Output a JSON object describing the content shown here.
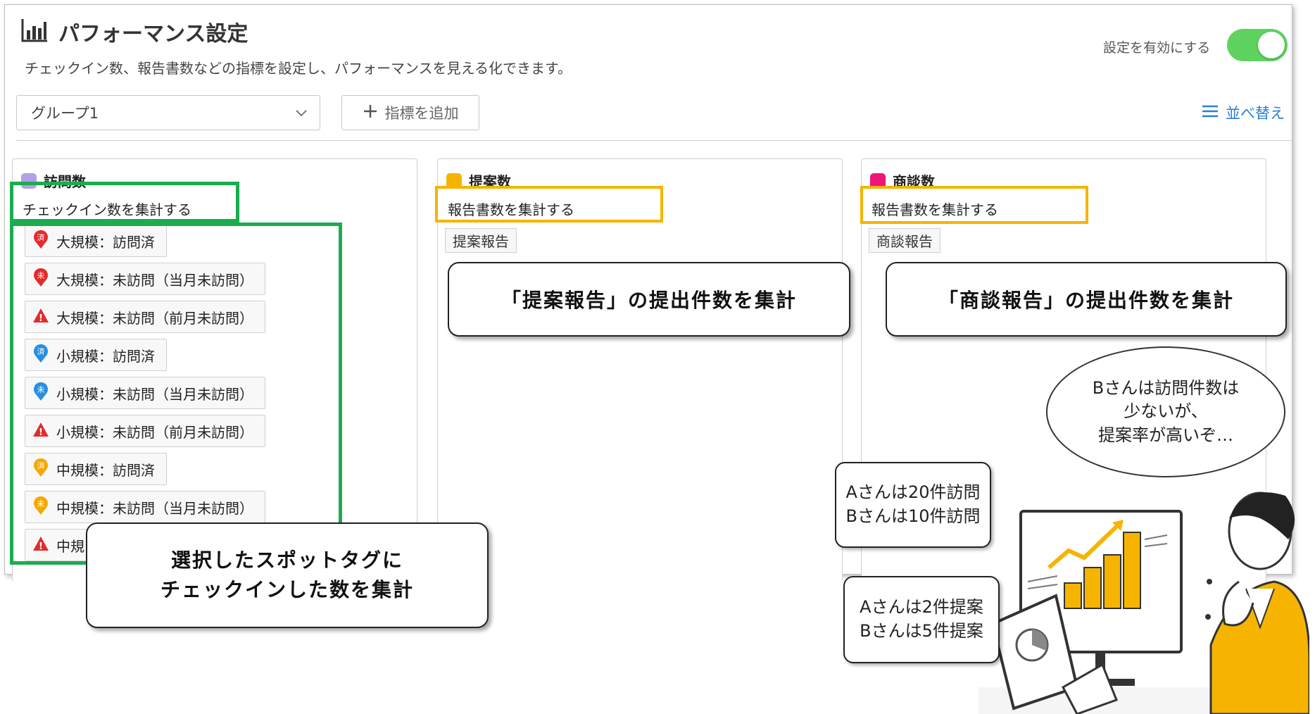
{
  "header": {
    "title": "パフォーマンス設定",
    "subtitle": "チェックイン数、報告書数などの指標を設定し、パフォーマンスを見える化できます。",
    "toggle_label": "設定を有効にする",
    "toggle_on": true
  },
  "toolbar": {
    "group_select": "グループ1",
    "add_metric": "指標を追加",
    "sort": "並べ替え"
  },
  "colors": {
    "green": "#1aac4f",
    "yellow": "#f6b400",
    "purple": "#b79ee8",
    "orange": "#f6b400",
    "pink": "#f0157a",
    "link": "#2a7fd4"
  },
  "metrics": [
    {
      "name": "訪問数",
      "mode": "チェックイン数を集計する",
      "tags": [
        {
          "label": "大規模：訪問済",
          "icon": "red-done-pin-icon"
        },
        {
          "label": "大規模：未訪問（当月未訪問）",
          "icon": "red-unvisited-pin-icon"
        },
        {
          "label": "大規模：未訪問（前月未訪問）",
          "icon": "red-warning-icon"
        },
        {
          "label": "小規模：訪問済",
          "icon": "blue-done-pin-icon"
        },
        {
          "label": "小規模：未訪問（当月未訪問）",
          "icon": "blue-unvisited-pin-icon"
        },
        {
          "label": "小規模：未訪問（前月未訪問）",
          "icon": "red-warning-icon"
        },
        {
          "label": "中規模：訪問済",
          "icon": "orange-done-pin-icon"
        },
        {
          "label": "中規模：未訪問（当月未訪問）",
          "icon": "orange-unvisited-pin-icon"
        },
        {
          "label": "中規",
          "icon": "red-warning-icon"
        }
      ]
    },
    {
      "name": "提案数",
      "mode": "報告書数を集計する",
      "report": "提案報告"
    },
    {
      "name": "商談数",
      "mode": "報告書数を集計する",
      "report": "商談報告"
    }
  ],
  "callouts": {
    "proposal": "「提案報告」の提出件数を集計",
    "negotiation": "「商談報告」の提出件数を集計",
    "spot_line1": "選択したスポットタグに",
    "spot_line2": "チェックインした数を集計"
  },
  "illustration": {
    "thought_line1": "Bさんは訪問件数は",
    "thought_line2": "少ないが、",
    "thought_line3": "提案率が高いぞ…",
    "visits_line1": "Aさんは20件訪問",
    "visits_line2": "Bさんは10件訪問",
    "proposals_line1": "Aさんは2件提案",
    "proposals_line2": "Bさんは5件提案"
  },
  "glyphs": {
    "done": "済",
    "unvisited": "未",
    "warning": "!"
  }
}
